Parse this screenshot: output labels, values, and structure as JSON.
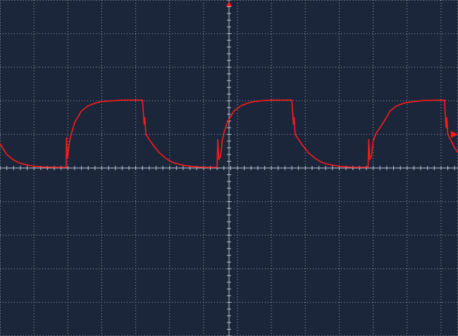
{
  "colors": {
    "background": "#1c263a",
    "grid": "#9aa6b4",
    "axis": "#b8c4d2",
    "trace": "#ff1a1a",
    "marker": "#ff1a1a"
  },
  "icons": {
    "trigger_position": "trigger-position-marker",
    "trigger_level": "trigger-level-marker"
  },
  "chart_data": {
    "type": "line",
    "title": "",
    "xlabel": "",
    "ylabel": "",
    "grid": true,
    "divisions": {
      "x": 13.5,
      "y": 10
    },
    "xlim": [
      0,
      13.5
    ],
    "ylim": [
      -5,
      5
    ],
    "trigger_level": 1,
    "series": [
      {
        "x": [
          0.0,
          0.2,
          0.4,
          0.6,
          0.8,
          1.0,
          1.3,
          1.6,
          1.95,
          1.96,
          1.98,
          2.0,
          2.05,
          2.1,
          2.2,
          2.4,
          2.6,
          2.8,
          3.0,
          3.3,
          3.6,
          4.0,
          4.2,
          4.25,
          4.27,
          4.3,
          4.5,
          4.7,
          4.9,
          5.1,
          5.4,
          5.7,
          6.0,
          6.4,
          6.42,
          6.45,
          6.5,
          6.55,
          6.6,
          6.7,
          6.9,
          7.1,
          7.3,
          7.5,
          7.8,
          8.1,
          8.6,
          8.65,
          8.67,
          8.7,
          8.9,
          9.1,
          9.3,
          9.5,
          9.8,
          10.1,
          10.4,
          10.85,
          10.87,
          10.9,
          10.95,
          11.0,
          11.1,
          11.3,
          11.5,
          11.7,
          11.9,
          12.2,
          12.5,
          13.1,
          13.15,
          13.17,
          13.2,
          13.3,
          13.4,
          13.5
        ],
        "y": [
          0.73,
          0.4,
          0.24,
          0.14,
          0.09,
          0.05,
          0.03,
          0.02,
          0.02,
          0.9,
          0.3,
          0.35,
          0.8,
          1.0,
          1.35,
          1.7,
          1.85,
          1.93,
          1.98,
          2.0,
          2.02,
          2.02,
          2.02,
          1.3,
          1.5,
          1.0,
          0.7,
          0.45,
          0.28,
          0.16,
          0.08,
          0.04,
          0.02,
          0.02,
          0.85,
          0.25,
          0.35,
          0.8,
          1.05,
          1.35,
          1.7,
          1.85,
          1.93,
          1.98,
          2.01,
          2.02,
          2.02,
          1.3,
          1.5,
          1.0,
          0.7,
          0.45,
          0.28,
          0.16,
          0.08,
          0.04,
          0.02,
          0.02,
          0.85,
          0.25,
          0.35,
          0.8,
          1.05,
          1.35,
          1.7,
          1.85,
          1.93,
          1.98,
          2.01,
          2.02,
          1.2,
          1.5,
          1.0,
          0.8,
          0.6,
          0.45
        ]
      }
    ]
  }
}
